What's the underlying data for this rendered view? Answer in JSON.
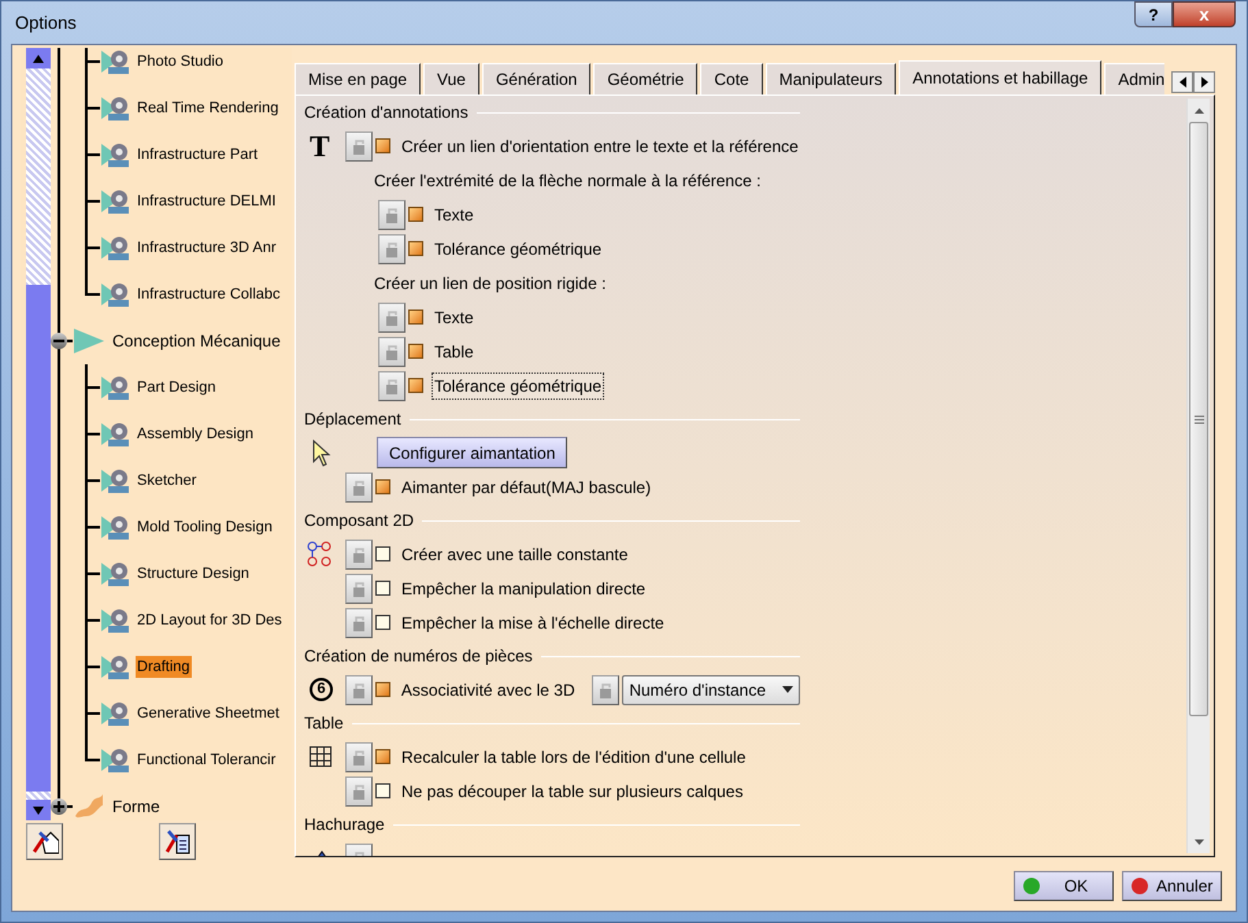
{
  "window": {
    "title": "Options",
    "help_button": "?",
    "close_button": "x"
  },
  "tree": {
    "upper_branch_children": [
      {
        "label": "Photo Studio",
        "selected": false
      },
      {
        "label": "Real Time Rendering",
        "selected": false
      },
      {
        "label": "Infrastructure Part",
        "selected": false
      },
      {
        "label": "Infrastructure DELMI",
        "selected": false
      },
      {
        "label": "Infrastructure 3D Anr",
        "selected": false
      },
      {
        "label": "Infrastructure Collabc",
        "selected": false
      }
    ],
    "nodes": [
      {
        "label": "Conception Mécanique",
        "expanded": true,
        "children": [
          {
            "label": "Part Design",
            "selected": false
          },
          {
            "label": "Assembly Design",
            "selected": false
          },
          {
            "label": "Sketcher",
            "selected": false
          },
          {
            "label": "Mold Tooling Design",
            "selected": false
          },
          {
            "label": "Structure Design",
            "selected": false
          },
          {
            "label": "2D Layout for 3D Des",
            "selected": false
          },
          {
            "label": "Drafting",
            "selected": true
          },
          {
            "label": "Generative Sheetmet",
            "selected": false
          },
          {
            "label": "Functional Tolerancir",
            "selected": false
          }
        ]
      },
      {
        "label": "Forme",
        "expanded": false
      }
    ]
  },
  "tabs": [
    {
      "label": "Mise en page",
      "selected": false
    },
    {
      "label": "Vue",
      "selected": false
    },
    {
      "label": "Génération",
      "selected": false
    },
    {
      "label": "Géométrie",
      "selected": false
    },
    {
      "label": "Cote",
      "selected": false
    },
    {
      "label": "Manipulateurs",
      "selected": false
    },
    {
      "label": "Annotations et habillage",
      "selected": true
    },
    {
      "label": "Admin",
      "selected": false
    }
  ],
  "sections": [
    {
      "kind": "annotations",
      "title": "Création d'annotations",
      "rows": [
        {
          "kind": "option",
          "icon_text": "T",
          "label": "Créer un lien d'orientation entre le texte et la référence",
          "checked": true,
          "focused": false
        },
        {
          "kind": "subheading",
          "label": "Créer l'extrémité de la flèche normale à la référence :"
        },
        {
          "kind": "suboption",
          "label": "Texte",
          "checked": true,
          "focused": false
        },
        {
          "kind": "suboption",
          "label": "Tolérance géométrique",
          "checked": true,
          "focused": false
        },
        {
          "kind": "subheading",
          "label": "Créer un lien de position rigide :"
        },
        {
          "kind": "suboption",
          "label": "Texte",
          "checked": true,
          "focused": false
        },
        {
          "kind": "suboption",
          "label": "Table",
          "checked": true,
          "focused": false
        },
        {
          "kind": "suboption",
          "label": "Tolérance géométrique",
          "checked": true,
          "focused": true
        }
      ]
    },
    {
      "kind": "move",
      "title": "Déplacement",
      "rows": [
        {
          "kind": "button",
          "label": "Configurer aimantation"
        },
        {
          "kind": "option",
          "label": "Aimanter par défaut(MAJ bascule)",
          "checked": true,
          "focused": false
        }
      ]
    },
    {
      "kind": "component",
      "title": "Composant 2D",
      "rows": [
        {
          "kind": "option",
          "label": "Créer avec une taille constante",
          "checked": false,
          "focused": false
        },
        {
          "kind": "option",
          "label": "Empêcher la manipulation directe",
          "checked": false,
          "focused": false
        },
        {
          "kind": "option",
          "label": "Empêcher la mise à l'échelle directe",
          "checked": false,
          "focused": false
        }
      ]
    },
    {
      "kind": "balloon",
      "title": "Création de numéros de pièces",
      "rows": [
        {
          "kind": "option_dropdown",
          "icon_text": "6",
          "label": "Associativité avec le 3D",
          "checked": true,
          "focused": false,
          "dropdown": "Numéro d'instance"
        }
      ]
    },
    {
      "kind": "table",
      "title": "Table",
      "rows": [
        {
          "kind": "option",
          "label": "Recalculer la table lors de l'édition d'une cellule",
          "checked": true,
          "focused": false
        },
        {
          "kind": "option",
          "label": "Ne pas découper la table sur plusieurs calques",
          "checked": false,
          "focused": false
        }
      ]
    },
    {
      "kind": "hatch",
      "title": "Hachurage",
      "rows": [
        {
          "kind": "partial"
        }
      ]
    }
  ],
  "buttons": [
    {
      "kind": "ok",
      "label": "OK"
    },
    {
      "kind": "cancel",
      "label": "Annuler"
    }
  ]
}
